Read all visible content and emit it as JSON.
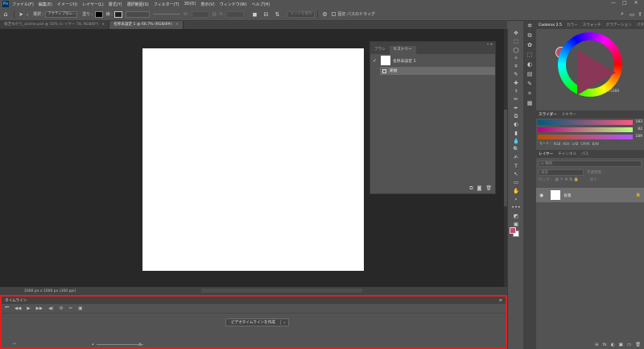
{
  "app": {
    "logo": "Ps"
  },
  "menu": [
    "ファイル(F)",
    "編集(E)",
    "イメージ(I)",
    "レイヤー(L)",
    "書式(Y)",
    "選択範囲(S)",
    "フィルター(T)",
    "3D(D)",
    "表示(V)",
    "ウィンドウ(W)",
    "ヘルプ(H)"
  ],
  "window_controls": [
    "—",
    "□",
    "✕"
  ],
  "options": {
    "select_label": "選択 :",
    "select_value": "アクティブなレ…",
    "fill_label": "塗り :",
    "stroke_label": "線 :",
    "w_label": "W :",
    "h_label": "H :",
    "auto_label": "エッジを整列",
    "drag_label": "固定 パスのドラッグ"
  },
  "tabs": [
    {
      "label": "紙芝ゆかり_anime.psd @ 50% (レイヤー 78, RGB/8*)",
      "close": "×"
    },
    {
      "label": "名称未設定 1 @ 66.7% (RGB/8#)",
      "close": "×"
    }
  ],
  "status": {
    "text": "1000 px x 1000 px (300 ppi)"
  },
  "history_panel": {
    "collapse": "« ≡",
    "tabs": [
      "ブラシ",
      "ヒストリー"
    ],
    "snapshot_label": "名称未設定 1",
    "state_label": "新規"
  },
  "timeline": {
    "title": "タイムライン",
    "menu_icon": "≡",
    "controls": [
      "⏮",
      "◀◀",
      "▶",
      "▶▶",
      "◀)",
      "⚙",
      "✂",
      "▣"
    ],
    "create_button": "ビデオタイムラインを作成",
    "create_dropdown": "⌄",
    "footer_left": "↩",
    "footer_mid": "▲"
  },
  "tools": [
    "✥",
    "⬚",
    "◯",
    "✧",
    "⌗",
    "✎",
    "✚",
    "⚕",
    "✏",
    "✒",
    "⧉",
    "◐",
    "▮",
    "💧",
    "🔍",
    "✍",
    "T",
    "↖",
    "▭",
    "✋",
    "⌕",
    "•••",
    "◩",
    "▣",
    "◫"
  ],
  "iconcol": [
    "✲",
    "⧉",
    "✿",
    "⬚",
    "◐",
    "▤",
    "✎",
    "⌗",
    "▦"
  ],
  "color_panel": {
    "tabs": [
      "Coolorus 2.5",
      "カラー",
      "スウォッチ",
      "グラデーション",
      "パターン"
    ],
    "hex": "B75280",
    "current_color": "#b94d6c"
  },
  "sliders": {
    "tabs": [
      "スライダー",
      "ミキサー"
    ],
    "rows": [
      {
        "value": "183",
        "gradient": "linear-gradient(to right,#005a80,#ff5a80)"
      },
      {
        "value": "82",
        "gradient": "linear-gradient(to right,#b70080,#b7ff80)"
      },
      {
        "value": "189",
        "gradient": "linear-gradient(to right,#b75200,#b752ff)"
      }
    ],
    "modes": [
      "モード :",
      "RGB",
      "HSV",
      "LAB",
      "CMYK",
      "B/W"
    ]
  },
  "layers": {
    "tabs": [
      "レイヤー",
      "チャンネル",
      "パス"
    ],
    "search_placeholder": "Q 種類",
    "blend_mode": "通常",
    "opacity_label": "不透明度 :",
    "lock_label": "ロック :",
    "fill_label": "塗り :",
    "layer_name": "背景",
    "footer_icons": [
      "⊖",
      "fx",
      "◐",
      "▣",
      "▭",
      "🗑"
    ]
  }
}
